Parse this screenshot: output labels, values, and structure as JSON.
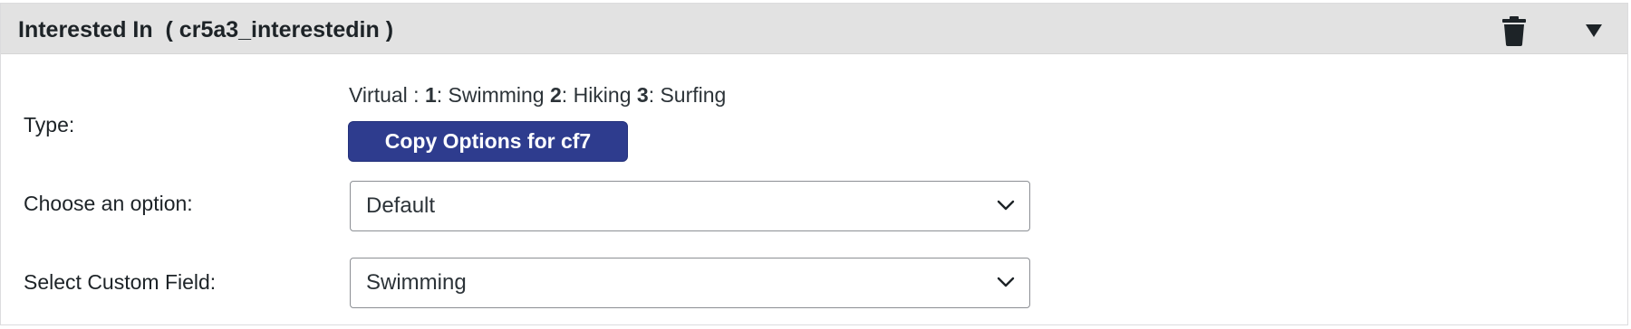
{
  "header": {
    "title": "Interested In  ( cr5a3_interestedin )",
    "delete_icon": "trash-icon",
    "toggle_icon": "caret-down-icon"
  },
  "type_row": {
    "label": "Type:",
    "options_prefix": "Virtual : ",
    "options": [
      {
        "key": "1",
        "sep": ": ",
        "value": "Swimming"
      },
      {
        "key": "2",
        "sep": ": ",
        "value": "Hiking"
      },
      {
        "key": "3",
        "sep": ": ",
        "value": "Surfing"
      }
    ],
    "copy_button_label": "Copy Options for cf7",
    "button_color": "#2e3c8e"
  },
  "choose_row": {
    "label": "Choose an option:",
    "selected": "Default"
  },
  "custom_field_row": {
    "label": "Select Custom Field:",
    "selected": "Swimming"
  },
  "colors": {
    "header_bg": "#e2e2e2",
    "border": "#8c8f94"
  }
}
